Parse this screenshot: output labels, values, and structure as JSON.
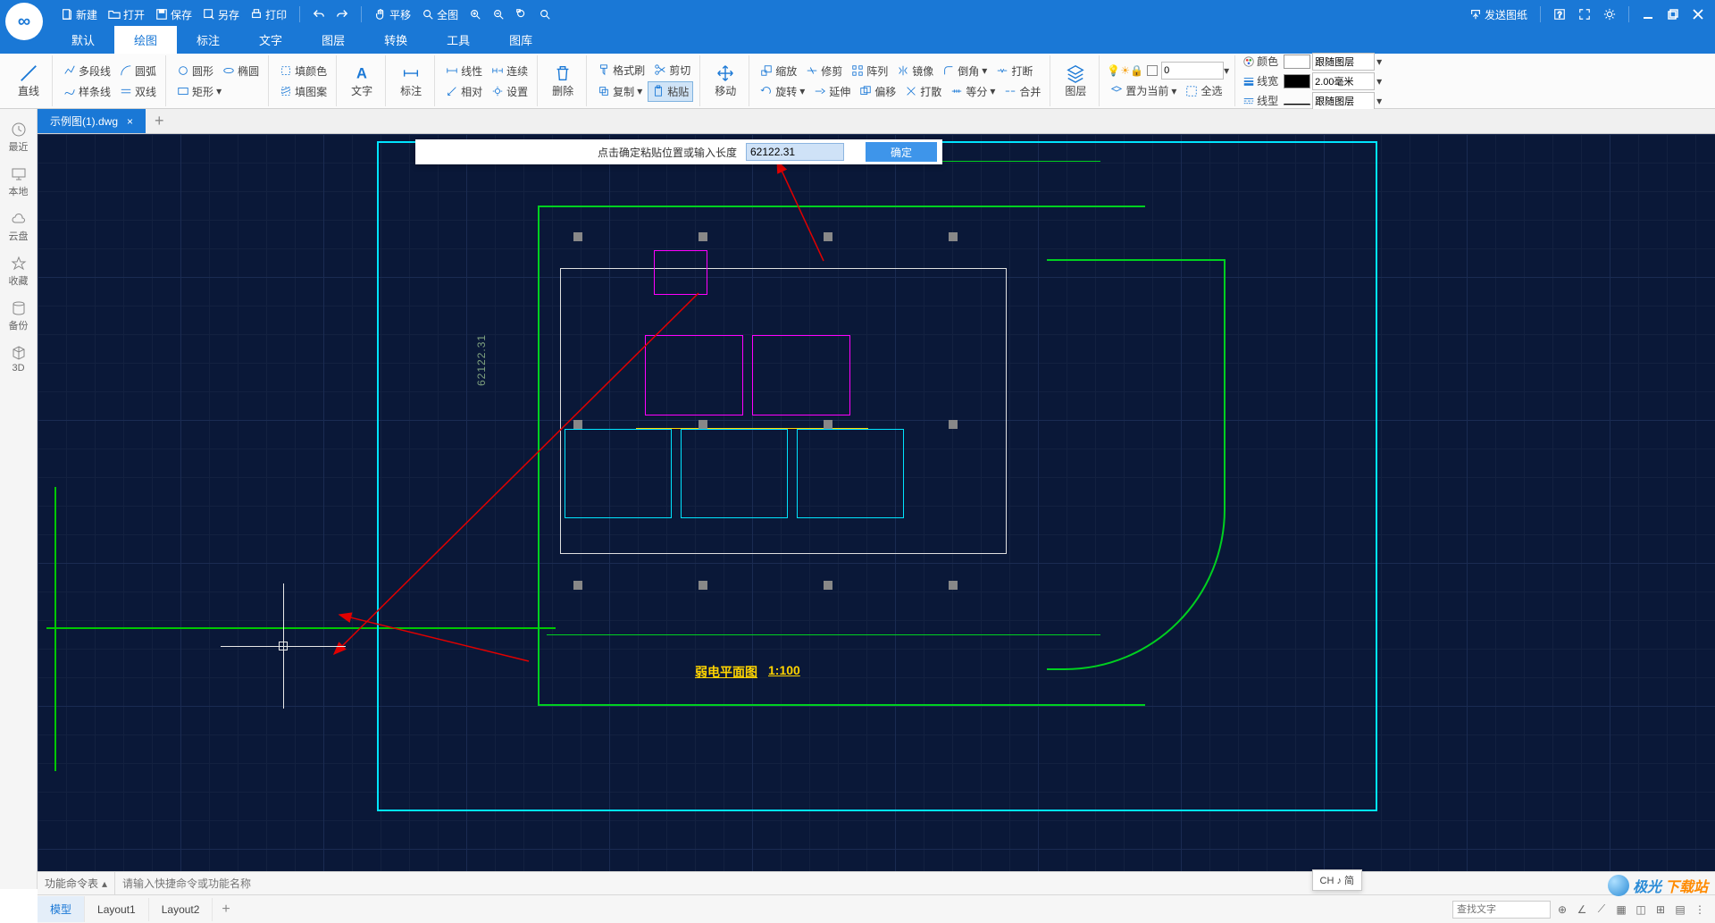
{
  "titlebar": {
    "new": "新建",
    "open": "打开",
    "save": "保存",
    "saveas": "另存",
    "print": "打印",
    "pan": "平移",
    "fitall": "全图",
    "send": "发送图纸"
  },
  "menutabs": [
    "默认",
    "绘图",
    "标注",
    "文字",
    "图层",
    "转换",
    "工具",
    "图库"
  ],
  "menutab_active_index": 1,
  "ribbon": {
    "line": "直线",
    "polyline": "多段线",
    "arc": "圆弧",
    "spline": "样条线",
    "dline": "双线",
    "circle": "圆形",
    "rect": "矩形",
    "ellipse": "椭圆",
    "fillcolor": "填颜色",
    "fillpat": "填图案",
    "text": "文字",
    "annot": "标注",
    "linear": "线性",
    "relative": "相对",
    "continuous": "连续",
    "settings": "设置",
    "delete": "删除",
    "fmt": "格式刷",
    "copy": "复制",
    "cut": "剪切",
    "paste": "粘贴",
    "move": "移动",
    "zoom": "缩放",
    "rotate": "旋转",
    "trim": "修剪",
    "extend": "延伸",
    "array": "阵列",
    "offset": "偏移",
    "mirror": "镜像",
    "explode": "打散",
    "fillet": "倒角",
    "equal": "等分",
    "break": "打断",
    "union": "合并",
    "layer": "图层",
    "setcur": "置为当前",
    "selall": "全选",
    "layer_value": "0",
    "props": {
      "color_label": "颜色",
      "color_value": "跟随图层",
      "lw_label": "线宽",
      "lw_value": "2.00毫米",
      "lt_label": "线型",
      "lt_value": "跟随图层"
    }
  },
  "leftbar": [
    {
      "icon": "clock",
      "label": "最近"
    },
    {
      "icon": "monitor",
      "label": "本地"
    },
    {
      "icon": "cloud",
      "label": "云盘"
    },
    {
      "icon": "star",
      "label": "收藏"
    },
    {
      "icon": "db",
      "label": "备份"
    },
    {
      "icon": "cube",
      "label": "3D"
    }
  ],
  "doctab": {
    "name": "示例图(1).dwg"
  },
  "prompt": {
    "msg": "点击确定粘贴位置或输入长度",
    "value": "62122.31",
    "ok": "确定"
  },
  "drawing": {
    "dim_value": "62122.31",
    "title": "弱电平面图",
    "scale": "1:100"
  },
  "cmd": {
    "label": "功能命令表",
    "placeholder": "请输入快捷命令或功能名称"
  },
  "bottom": {
    "tabs": [
      "模型",
      "Layout1",
      "Layout2"
    ],
    "active_index": 0,
    "search_placeholder": "查找文字",
    "ime": "CH ♪ 简"
  },
  "watermark": {
    "a": "极光",
    "b": "下载站"
  },
  "colors": {
    "accent": "#1a78d6",
    "canvas": "#0a1838",
    "cyan": "#00e5ff",
    "green": "#00d020",
    "magenta": "#ff00ff",
    "yellow": "#ffd400"
  }
}
